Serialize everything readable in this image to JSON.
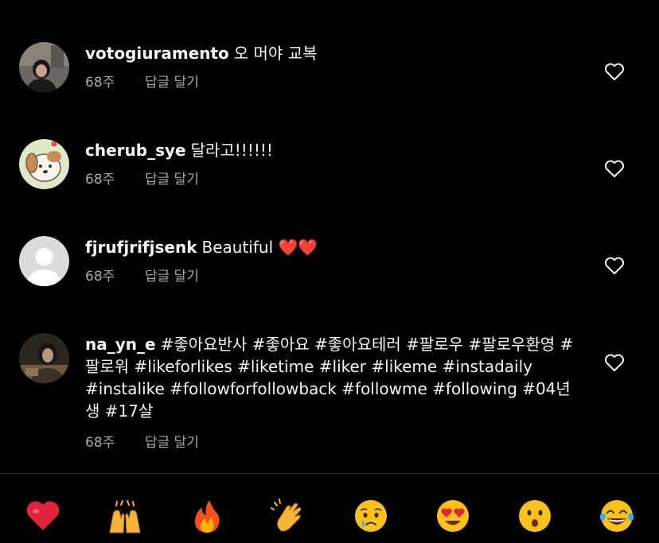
{
  "comments": [
    {
      "username": "votogiuramento",
      "text": "오 머야 교복",
      "age": "68주",
      "reply_label": "답글 달기",
      "avatar_icon": "photo-avatar-girl"
    },
    {
      "username": "cherub_sye",
      "text": "달라고!!!!!!",
      "age": "68주",
      "reply_label": "답글 달기",
      "avatar_icon": "cartoon-dog-avatar"
    },
    {
      "username": "fjrufjrifjsenk",
      "text": "Beautiful ❤️❤️",
      "age": "68주",
      "reply_label": "답글 달기",
      "avatar_icon": "default-user-avatar"
    },
    {
      "username": "na_yn_e",
      "text": "#좋아요반사 #좋아요 #좋아요테러 #팔로우 #팔로우환영 #팔로워 #likeforlikes #liketime #liker #likeme #instadaily #instalike #followforfollowback #followme #following #04년생 #17살",
      "age": "68주",
      "reply_label": "답글 달기",
      "avatar_icon": "photo-avatar-girl"
    }
  ],
  "emoji_bar": [
    {
      "name": "red-heart",
      "glyph": "❤️"
    },
    {
      "name": "raising-hands",
      "glyph": "🙌"
    },
    {
      "name": "fire",
      "glyph": "🔥"
    },
    {
      "name": "clapping-hands",
      "glyph": "👏"
    },
    {
      "name": "crying-face",
      "glyph": "😢"
    },
    {
      "name": "heart-eyes-face",
      "glyph": "😍"
    },
    {
      "name": "surprised-face",
      "glyph": "😮"
    },
    {
      "name": "tears-of-joy-face",
      "glyph": "😂"
    }
  ],
  "colors": {
    "background": "#000000",
    "text": "#f5f5f5",
    "meta": "#a8a8a8",
    "heart_red": "#ed4956"
  }
}
